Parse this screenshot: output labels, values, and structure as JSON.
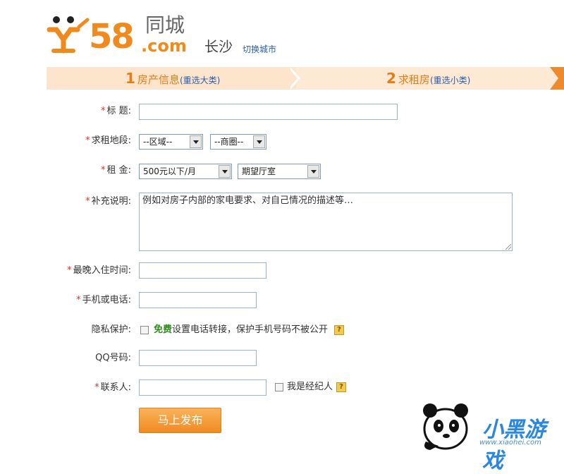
{
  "header": {
    "logo_58": "58",
    "logo_tongcheng": "同城",
    "logo_com": ".com",
    "city": "长沙",
    "switch_city": "切换城市"
  },
  "steps": [
    {
      "num": "1",
      "label": "房产信息",
      "link": "(重选大类)"
    },
    {
      "num": "2",
      "label": "求租房",
      "link": "(重选小类)"
    }
  ],
  "colors": {
    "accent": "#f08a1c",
    "link": "#2a5daa",
    "required": "#e0302a"
  },
  "form": {
    "title_label": "标 题:",
    "area_label": "求租地段:",
    "district_select": "--区域--",
    "circle_select": "--商圈--",
    "rent_label": "租 金:",
    "rent_select": "500元以下/月",
    "room_select": "期望厅室",
    "desc_label": "补充说明:",
    "desc_value": "例如对房子内部的家电要求、对自己情况的描述等…",
    "latest_label": "最晚入住时间:",
    "phone_label": "手机或电话:",
    "privacy_label": "隐私保护:",
    "privacy_free": "免费",
    "privacy_text": "设置电话转接，保护手机号码不被公开",
    "qq_label": "QQ号码:",
    "contact_label": "联系人:",
    "agent_label": "我是经纪人",
    "help_mark": "?",
    "required_mark": "*",
    "submit": "马上发布"
  },
  "watermark": {
    "brand": "小黑游戏",
    "url": "www.xiaohei.com"
  }
}
